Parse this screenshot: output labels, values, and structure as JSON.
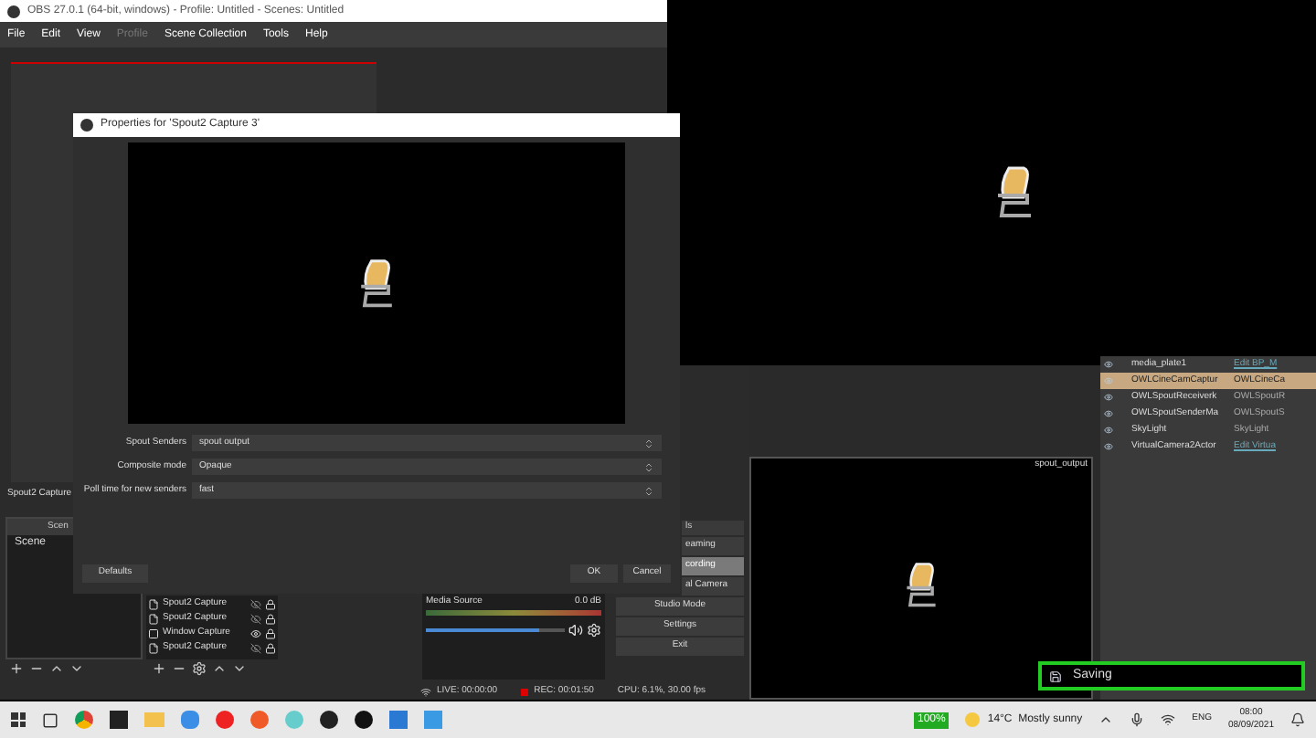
{
  "obs_window": {
    "title": "OBS 27.0.1 (64-bit, windows) - Profile: Untitled - Scenes: Untitled",
    "menu": [
      {
        "label": "File",
        "disabled": false
      },
      {
        "label": "Edit",
        "disabled": false
      },
      {
        "label": "View",
        "disabled": false
      },
      {
        "label": "Profile",
        "disabled": true
      },
      {
        "label": "Scene Collection",
        "disabled": false
      },
      {
        "label": "Tools",
        "disabled": false
      },
      {
        "label": "Help",
        "disabled": false
      }
    ],
    "source_title": "Spout2 Capture",
    "scenes_header": "Scen",
    "scenes": [
      {
        "name": "Scene",
        "selected": false
      }
    ],
    "sources": [
      {
        "name": "Spout2 Capture",
        "kind": "spout",
        "visible": false
      },
      {
        "name": "Spout2 Capture",
        "kind": "spout",
        "visible": false
      },
      {
        "name": "Window Capture",
        "kind": "window",
        "visible": true
      },
      {
        "name": "Spout2 Capture",
        "kind": "spout",
        "visible": false
      }
    ],
    "mixer": {
      "name": "Media Source",
      "reading": "0.0 dB",
      "level": 0.82
    },
    "controls": [
      {
        "label": "eaming",
        "kind": "partial",
        "selected": false
      },
      {
        "label": "cording",
        "kind": "partial",
        "selected": true
      },
      {
        "label": "al Camera",
        "kind": "partial",
        "selected": false
      },
      {
        "label": "Studio Mode",
        "kind": "full",
        "selected": false
      },
      {
        "label": "Settings",
        "kind": "full",
        "selected": false
      },
      {
        "label": "Exit",
        "kind": "full",
        "selected": false
      }
    ],
    "controls_header": "ls",
    "status": {
      "live": "LIVE: 00:00:00",
      "rec": "REC: 00:01:50",
      "cpu": "CPU: 6.1%, 30.00 fps"
    }
  },
  "properties_dialog": {
    "title": "Properties for 'Spout2 Capture 3'",
    "fields": [
      {
        "label": "Spout Senders",
        "value": "spout output"
      },
      {
        "label": "Composite mode",
        "value": "Opaque"
      },
      {
        "label": "Poll time for new senders",
        "value": "fast"
      }
    ],
    "buttons": {
      "defaults": "Defaults",
      "ok": "OK",
      "cancel": "Cancel"
    }
  },
  "viewport": {
    "label": "spout_output"
  },
  "outliner": [
    {
      "name": "media_plate1",
      "type": "Edit BP_M",
      "link": true,
      "selected": false
    },
    {
      "name": "OWLCineCamCaptur",
      "type": "OWLCineCa",
      "link": false,
      "selected": true
    },
    {
      "name": "OWLSpoutReceiverk",
      "type": "OWLSpoutR",
      "link": false,
      "selected": false
    },
    {
      "name": "OWLSpoutSenderMa",
      "type": "OWLSpoutS",
      "link": false,
      "selected": false
    },
    {
      "name": "SkyLight",
      "type": "SkyLight",
      "link": false,
      "selected": false
    },
    {
      "name": "VirtualCamera2Actor",
      "type": "Edit Virtua",
      "link": true,
      "selected": false
    }
  ],
  "toast": {
    "text": "Saving"
  },
  "taskbar": {
    "battery": "100%",
    "weather": "14°C  Mostly sunny",
    "language": "ENG",
    "time": "08:00",
    "date": "08/09/2021"
  }
}
